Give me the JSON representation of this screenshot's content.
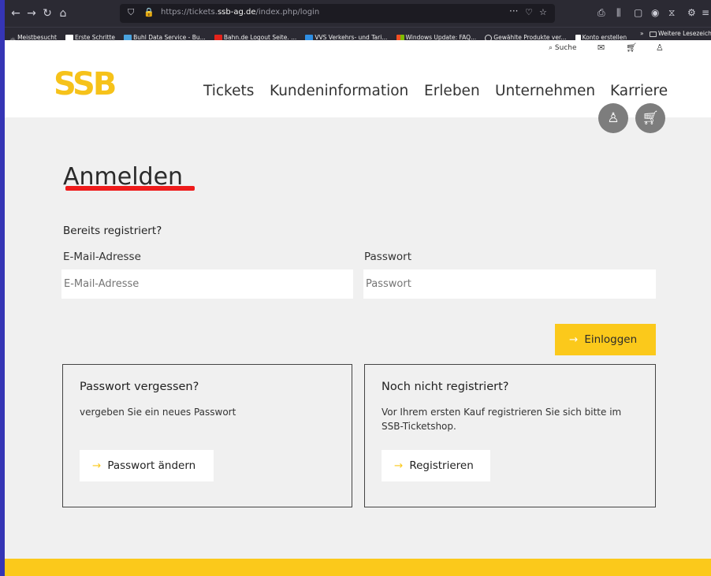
{
  "browser": {
    "url_prefix": "https://tickets.",
    "url_domain": "ssb-ag.de",
    "url_path": "/index.php/login",
    "more": "···",
    "bookmarks": [
      "Meistbesucht",
      "Erste Schritte",
      "Buhl Data Service - Bu...",
      "Bahn.de Logout Seite. ...",
      "VVS Verkehrs- und Tari...",
      "Windows Update: FAQ...",
      "Gewählte Produkte ver...",
      "Konto erstellen"
    ],
    "bookmarks_more": "»",
    "other_bookmarks": "Weitere Lesezeichen"
  },
  "site": {
    "logo": "SSB",
    "search": "Suche",
    "nav": [
      "Tickets",
      "Kundeninformation",
      "Erleben",
      "Unternehmen",
      "Karriere"
    ]
  },
  "login": {
    "title": "Anmelden",
    "subtitle": "Bereits registriert?",
    "email_label": "E-Mail-Adresse",
    "email_placeholder": "E-Mail-Adresse",
    "password_label": "Passwort",
    "password_placeholder": "Passwort",
    "login_button": "Einloggen"
  },
  "forgot": {
    "heading": "Passwort vergessen?",
    "text": "vergeben Sie ein neues Passwort",
    "button": "Passwort ändern"
  },
  "register": {
    "heading": "Noch nicht registriert?",
    "text": "Vor Ihrem ersten Kauf registrieren Sie sich bitte im SSB-Ticketshop.",
    "button": "Registrieren"
  },
  "colors": {
    "brand_yellow": "#fbc91b",
    "underline_red": "#ee1b1b"
  }
}
